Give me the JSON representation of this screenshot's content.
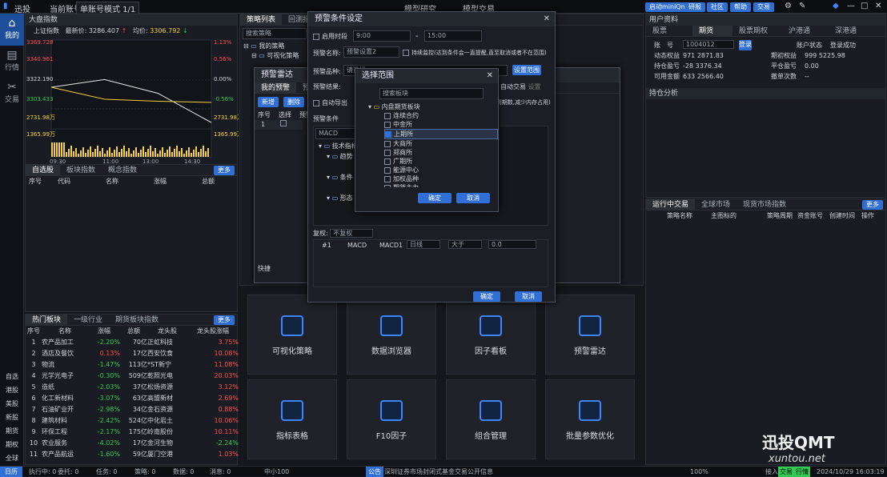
{
  "topbar": {
    "logo": "迅投",
    "account_label": "当前账号",
    "mode": "单账号模式 1/1",
    "center_tabs": [
      "模型研究",
      "模型交易"
    ],
    "right_items": [
      "启动miniQmt",
      "研报",
      "社区",
      "帮助",
      "交易"
    ]
  },
  "leftnav": {
    "items": [
      "我的",
      "行情",
      "交易"
    ],
    "bottom": [
      "自选",
      "港股",
      "美股",
      "新股",
      "期货",
      "期权",
      "全球",
      "日历"
    ]
  },
  "market": {
    "title": "大盘指数",
    "index_name": "上证指数",
    "latest_label": "最新价:",
    "latest": "3286.407",
    "arrow": "↑",
    "avg_label": "均价:",
    "avg": "3306.792",
    "arrow2": "↓",
    "yticks_left": [
      "3369.728",
      "3340.961",
      "3322.190",
      "3303.433",
      "2731.98万",
      "1365.99万"
    ],
    "yticks_right": [
      "1.13%",
      "0.56%",
      "0.00%",
      "-0.56%",
      "2731.98万",
      "1365.99万"
    ],
    "xticks": [
      "09:30",
      "11:00",
      "13:00",
      "14:30"
    ]
  },
  "chart_data": {
    "type": "line",
    "title": "上证指数",
    "x": [
      "09:30",
      "11:00",
      "13:00",
      "14:30"
    ],
    "price": [
      3322.19,
      3330,
      3316,
      3286.4
    ],
    "avg": [
      3322.19,
      3310,
      3308,
      3306.79
    ],
    "volume_max": "2731.98万",
    "volume_mid": "1365.99万"
  },
  "watch": {
    "tabs": [
      "自选股",
      "板块指数",
      "概念指数"
    ],
    "more": "更多",
    "columns": [
      "序号",
      "代码",
      "名称",
      "涨幅",
      "总额"
    ]
  },
  "strategy_tabs": [
    "策略列表",
    "回测报告"
  ],
  "strategy": {
    "search": "搜索策略",
    "tree": [
      "我的策略",
      "可视化策略"
    ]
  },
  "sectors": {
    "tabs": [
      "热门板块",
      "一级行业",
      "期货板块指数"
    ],
    "more": "更多",
    "columns": [
      "序号",
      "名称",
      "涨幅",
      "总额",
      "龙头股",
      "龙头股涨幅"
    ],
    "rows": [
      [
        "1",
        "农产品加工",
        "-2.20%",
        "70亿",
        "正虹科技",
        "3.75%"
      ],
      [
        "2",
        "酒店及餐饮",
        "0.13%",
        "17亿",
        "西安饮食",
        "10.08%"
      ],
      [
        "3",
        "物流",
        "-1.47%",
        "113亿",
        "*ST新宁",
        "11.08%"
      ],
      [
        "4",
        "光学光电子",
        "-0.30%",
        "509亿",
        "乾照光电",
        "20.03%"
      ],
      [
        "5",
        "造纸",
        "-2.03%",
        "37亿",
        "松炀资源",
        "3.12%"
      ],
      [
        "6",
        "化工新材料",
        "-3.07%",
        "63亿",
        "高盟新材",
        "2.69%"
      ],
      [
        "7",
        "石油矿业开",
        "-2.98%",
        "34亿",
        "金石资源",
        "0.88%"
      ],
      [
        "8",
        "建筑材料",
        "-2.42%",
        "524亿",
        "中化岩土",
        "10.06%"
      ],
      [
        "9",
        "环保工程",
        "-2.17%",
        "175亿",
        "岭南股份",
        "10.11%"
      ],
      [
        "10",
        "农业服务",
        "-4.02%",
        "17亿",
        "金河生物",
        "-2.24%"
      ],
      [
        "11",
        "农产品航运",
        "-1.60%",
        "59亿",
        "厦门空港",
        "1.03%"
      ]
    ]
  },
  "cards": [
    {
      "label": "可视化策略",
      "icon": "list-icon"
    },
    {
      "label": "数据浏览器",
      "icon": "browser-icon"
    },
    {
      "label": "因子看板",
      "icon": "factor-icon"
    },
    {
      "label": "预警雷达",
      "icon": "radar-icon"
    },
    {
      "label": "指标表格",
      "icon": "table-icon"
    },
    {
      "label": "F10因子",
      "icon": "f10-icon"
    },
    {
      "label": "组合管理",
      "icon": "portfolio-icon"
    },
    {
      "label": "批量参数优化",
      "icon": "gauge-icon"
    }
  ],
  "user": {
    "title": "用户资料",
    "tabs": [
      "股票",
      "期货",
      "股票期权",
      "沪港通",
      "深港通"
    ],
    "account_label": "账　号",
    "account": "1004012",
    "login": "登录",
    "status_label": "账户状态",
    "status": "登录成功",
    "fields": [
      [
        "动态权益",
        "971 2871.83",
        "期初权益",
        "999 5225.98"
      ],
      [
        "持仓盈亏",
        "-28 3376.34",
        "平仓盈亏",
        "0.00"
      ],
      [
        "可用金额",
        "633 2566.40",
        "撤单次数",
        "--"
      ]
    ],
    "rank": "持仓分析"
  },
  "running": {
    "tabs": [
      "运行中交易",
      "全球市场",
      "现货市场指数"
    ],
    "more": "更多",
    "columns": [
      "策略名称",
      "主图标的",
      "策略周期",
      "资金账号",
      "创建时间",
      "操作"
    ]
  },
  "radar": {
    "title": "预警雷达",
    "tabs": [
      "我的预警",
      "预警结果"
    ],
    "btns": [
      "新增",
      "删除"
    ],
    "cols": [
      "序号",
      "选择",
      "预警"
    ],
    "row": [
      "1"
    ],
    "bottom": "预警条件",
    "auto_label": "自动导出",
    "more": "快捷"
  },
  "cond": {
    "title": "预警条件设定",
    "enable_time": "启用时段",
    "time_from": "9:00",
    "time_to": "15:00",
    "name_label": "预警名称:",
    "name": "预警设置2",
    "monitor": "持续监控(达到条件会一直提醒,直至取消或者不在范围)",
    "range_label": "预警品种:",
    "range_ph": "请选择",
    "range_btn": "设置范围",
    "result_label": "预警结果:",
    "auto_trade": "自动交易",
    "auto_set": "设置",
    "export": "自动导出",
    "tip": "(到期数,减少内存占用)",
    "cond_label": "预警条件",
    "tree_search": "MACD",
    "tree": [
      "技术指标",
      "趋势",
      "条件",
      "形态"
    ],
    "fuquan_label": "复权:",
    "fuquan": "不复权",
    "row": [
      "#1",
      "MACD",
      "MACD1",
      "日线",
      "大于",
      "0.0"
    ],
    "ok": "确定",
    "cancel": "取消"
  },
  "scope": {
    "title": "选择范围",
    "search": "搜索板块",
    "root": "内盘期货板块",
    "items": [
      {
        "label": "连续合约",
        "on": false
      },
      {
        "label": "中金所",
        "on": false
      },
      {
        "label": "上期所",
        "on": true
      },
      {
        "label": "大商所",
        "on": false
      },
      {
        "label": "郑商所",
        "on": false
      },
      {
        "label": "广期所",
        "on": false
      },
      {
        "label": "能源中心",
        "on": false
      },
      {
        "label": "加权品种",
        "on": false
      },
      {
        "label": "期货主力",
        "on": false
      }
    ],
    "ok": "确定",
    "cancel": "取消"
  },
  "status": {
    "items": [
      "执行中:",
      "委托:",
      "任务:",
      "策略:",
      "数据:",
      "消息:"
    ],
    "counts": [
      "0",
      "0",
      "0",
      "0",
      "0",
      "0"
    ],
    "index": "中小100",
    "notice_label": "公告",
    "notice": "深圳证券市场封闭式基金交易公开信息",
    "zoom": "100%",
    "right": [
      "接入",
      "交易",
      "行情"
    ],
    "time": "2024/10/29 16:03:19"
  },
  "watermark": {
    "brand": "迅投QMT",
    "url": "xuntou.net"
  }
}
